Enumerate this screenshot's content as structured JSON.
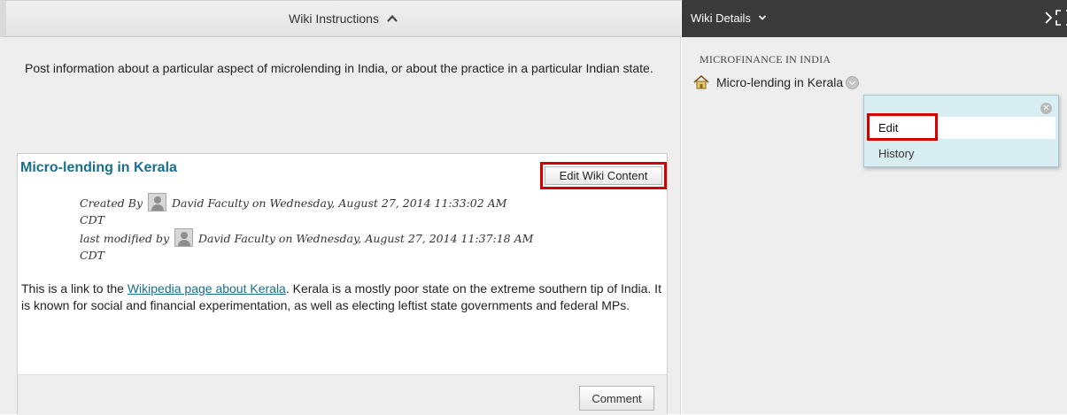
{
  "left_panel": {
    "header_title": "Wiki Instructions",
    "instructions": "Post information about a particular aspect of microlending in India, or about the practice in a particular Indian state."
  },
  "page": {
    "title": "Micro-lending in Kerala",
    "edit_button_label": "Edit Wiki Content",
    "created_by_label": "Created By",
    "created_by_text": "David Faculty on Wednesday, August 27, 2014 11:33:02 AM",
    "created_by_tz": "CDT",
    "modified_by_label": "last modified by",
    "modified_by_text": "David Faculty on Wednesday, August 27, 2014 11:37:18 AM CDT",
    "body_before_link": "This is a link to the ",
    "body_link": "Wikipedia page about Kerala",
    "body_after_link": ". Kerala is a mostly poor state on the extreme southern tip of India. It is known for social and financial experimentation, as well as electing leftist state governments and federal MPs.",
    "comment_button_label": "Comment"
  },
  "right_panel": {
    "header_title": "Wiki Details",
    "wiki_name": "MICROFINANCE IN INDIA",
    "page_link": "Micro-lending in Kerala",
    "context_menu": {
      "items": [
        "Edit",
        "History"
      ]
    }
  },
  "icons": {
    "header_caret": "chevron-up-icon",
    "details_dropdown": "chevron-down-icon",
    "next": "chevron-right-icon",
    "expand": "expand-icon",
    "home": "home-icon",
    "context": "context-menu-icon",
    "close": "close-icon",
    "avatar": "avatar-icon"
  },
  "colors": {
    "highlight": "#d40000",
    "link": "#1a6f8c",
    "right_header_bg": "#3a3a3a",
    "menu_bg": "#d8eef3"
  }
}
